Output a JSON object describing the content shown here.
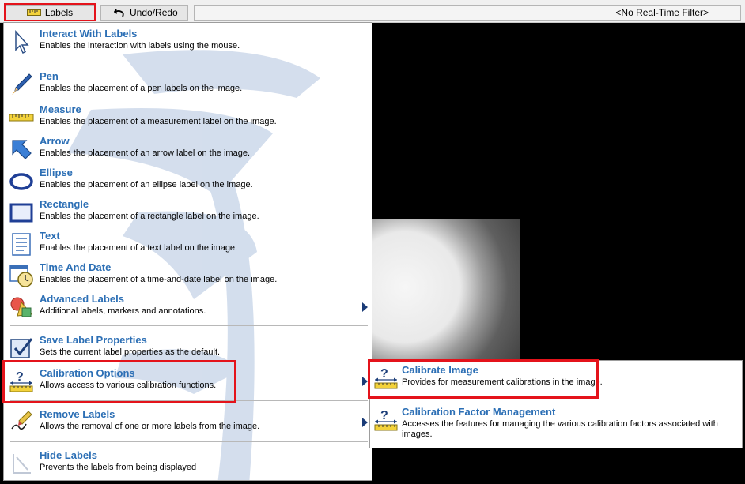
{
  "toolbar": {
    "labels_button": "Labels",
    "undo_redo_button": "Undo/Redo",
    "filter_text": "<No Real-Time Filter>"
  },
  "menu": {
    "items": [
      {
        "title": "Interact With Labels",
        "desc": "Enables the interaction with labels using the mouse.",
        "icon": "cursor-icon"
      },
      {
        "title": "Pen",
        "desc": "Enables the placement of a pen labels on the image.",
        "icon": "pen-icon"
      },
      {
        "title": "Measure",
        "desc": "Enables the placement of a measurement label on the image.",
        "icon": "ruler-icon"
      },
      {
        "title": "Arrow",
        "desc": "Enables the placement of an arrow label on the image.",
        "icon": "arrow-icon"
      },
      {
        "title": "Ellipse",
        "desc": "Enables the placement of an ellipse label on the image.",
        "icon": "ellipse-icon"
      },
      {
        "title": "Rectangle",
        "desc": "Enables the placement of a rectangle label on the image.",
        "icon": "rectangle-icon"
      },
      {
        "title": "Text",
        "desc": "Enables the placement of a text label on the image.",
        "icon": "text-icon"
      },
      {
        "title": "Time And Date",
        "desc": "Enables the placement of a time-and-date label on the image.",
        "icon": "clock-calendar-icon"
      },
      {
        "title": "Advanced Labels",
        "desc": "Additional labels, markers and annotations.",
        "icon": "shapes-icon"
      },
      {
        "title": "Save Label Properties",
        "desc": "Sets the current label properties as the default.",
        "icon": "checkbox-save-icon"
      },
      {
        "title": "Calibration Options",
        "desc": "Allows access to various calibration functions.",
        "icon": "calibration-icon"
      },
      {
        "title": "Remove Labels",
        "desc": "Allows the removal of one or more labels from the image.",
        "icon": "eraser-pen-icon"
      },
      {
        "title": "Hide Labels",
        "desc": "Prevents the labels from being displayed",
        "icon": "hide-labels-icon"
      }
    ]
  },
  "submenu": {
    "items": [
      {
        "title": "Calibrate Image",
        "desc": "Provides for measurement calibrations in the image.",
        "icon": "calibration-icon"
      },
      {
        "title": "Calibration Factor Management",
        "desc": "Accesses the features for managing the various calibration factors associated with images.",
        "icon": "calibration-icon"
      }
    ]
  },
  "colors": {
    "title_blue": "#2c6fb5",
    "highlight_red": "#e4131b"
  }
}
